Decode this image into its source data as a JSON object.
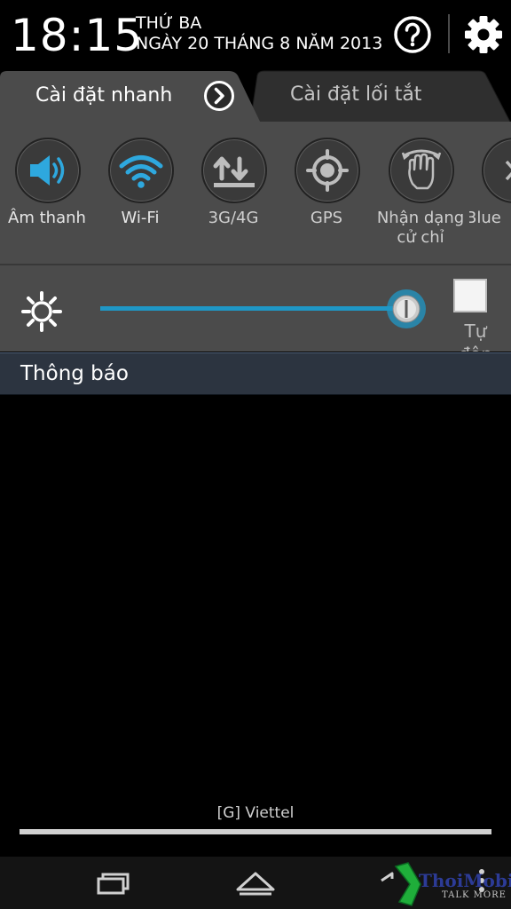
{
  "header": {
    "time": "18:15",
    "day_of_week": "THỨ BA",
    "date": "NGÀY 20 THÁNG 8 NĂM 2013"
  },
  "tabs": [
    {
      "label": "Cài đặt nhanh",
      "active": true
    },
    {
      "label": "Cài đặt lối tắt",
      "active": false
    }
  ],
  "quick_settings": [
    {
      "label": "Âm thanh",
      "icon": "speaker-icon",
      "active": true
    },
    {
      "label": "Wi-Fi",
      "icon": "wifi-icon",
      "active": true
    },
    {
      "label": "3G/4G",
      "icon": "mobile-data-icon",
      "active": false
    },
    {
      "label": "GPS",
      "icon": "gps-icon",
      "active": false
    },
    {
      "label": "Nhận dạng cử chỉ",
      "icon": "gesture-icon",
      "active": false
    },
    {
      "label": "Blue",
      "icon": "bluetooth-icon",
      "active": false
    }
  ],
  "brightness": {
    "level": 0.97,
    "auto_checked": false,
    "auto_label": "Tự độn"
  },
  "notifications": {
    "title": "Thông báo",
    "carrier": "[G] Viettel"
  },
  "watermark": {
    "brand": "ThoiMobile",
    "tagline": "TALK MORE"
  },
  "colors": {
    "accent": "#1f97c6",
    "panel": "#4b4b4b",
    "notif_bar": "#2c3440"
  }
}
